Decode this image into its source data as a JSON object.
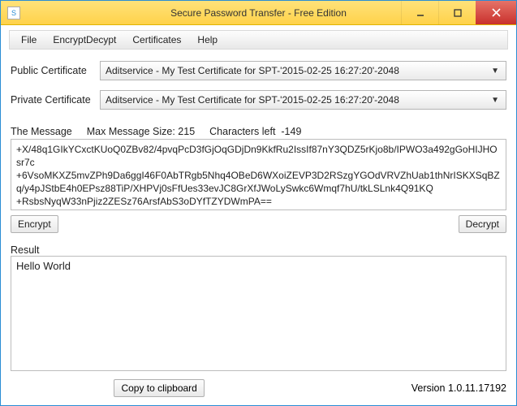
{
  "window": {
    "title": "Secure Password Transfer - Free Edition",
    "app_icon_char": "S"
  },
  "menu": {
    "file": "File",
    "encryptdecrypt": "EncryptDecypt",
    "certificates": "Certificates",
    "help": "Help"
  },
  "labels": {
    "public_cert": "Public Certificate",
    "private_cert": "Private Certificate",
    "the_message": "The Message",
    "max_msg_size_prefix": "Max Message Size:",
    "chars_left_prefix": "Characters left",
    "result": "Result",
    "version_prefix": "Version"
  },
  "certs": {
    "public_selected": "Aditservice - My Test Certificate for SPT-'2015-02-25 16:27:20'-2048",
    "private_selected": "Aditservice - My Test Certificate for SPT-'2015-02-25 16:27:20'-2048"
  },
  "message": {
    "max_size": "215",
    "chars_left": "-149",
    "text": "+X/48q1GIkYCxctKUoQ0ZBv82/4pvqPcD3fGjOqGDjDn9KkfRu2IssIf87nY3QDZ5rKjo8b/IPWO3a492gGoHIJHOsr7c\n+6VsoMKXZ5mvZPh9Da6ggI46F0AbTRgb5Nhq4OBeD6WXoiZEVP3D2RSzgYGOdVRVZhUab1thNrISKXSqBZq/y4pJStbE4h0EPsz88TiP/XHPVj0sFfUes33evJC8GrXfJWoLySwkc6Wmqf7hU/tkLSLnk4Q91KQ\n+RsbsNyqW33nPjiz2ZESz76ArsfAbS3oDYfTZYDWmPA=="
  },
  "buttons": {
    "encrypt": "Encrypt",
    "decrypt": "Decrypt",
    "copy": "Copy to clipboard"
  },
  "result_value": "Hello World",
  "version": "1.0.11.17192"
}
